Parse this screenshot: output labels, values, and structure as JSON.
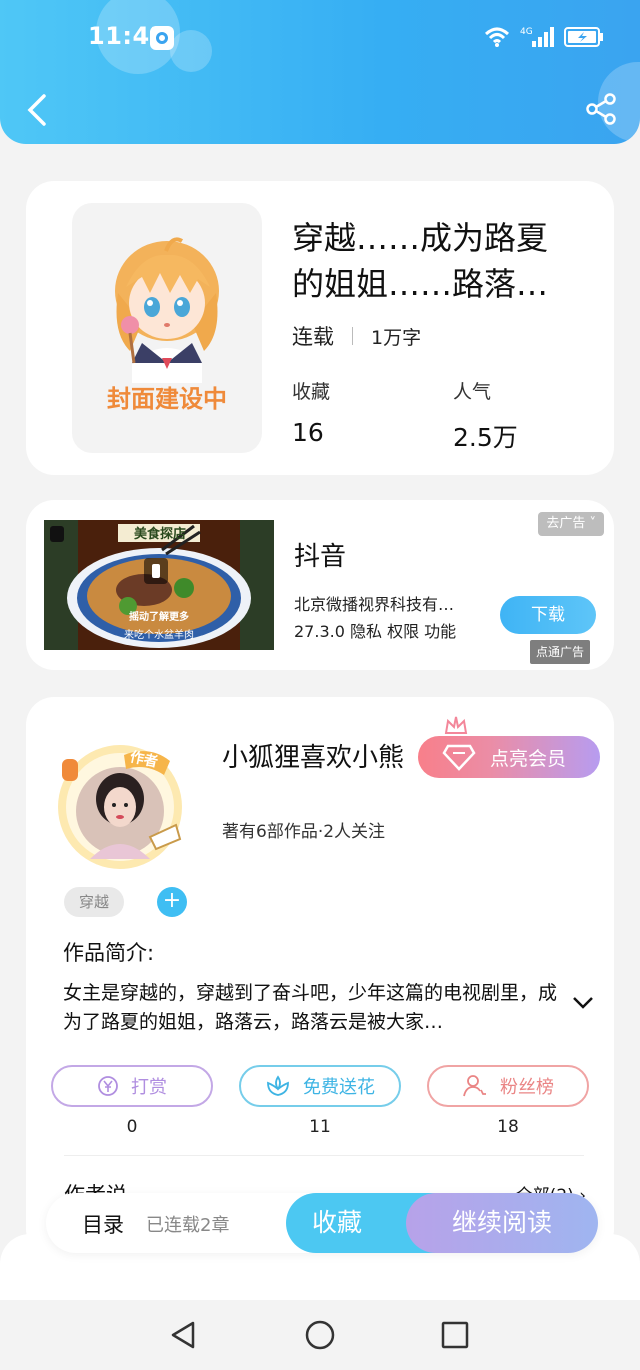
{
  "status_bar": {
    "time": "11:43",
    "network": "4G"
  },
  "book": {
    "title": "穿越……成为路夏的姐姐……路落…",
    "status": "连载",
    "word_count": "1万字",
    "cover_text": "封面建设中",
    "stats": [
      {
        "label": "收藏",
        "value": "16"
      },
      {
        "label": "人气",
        "value": "2.5万"
      }
    ]
  },
  "ad": {
    "app_name": "抖音",
    "company": "北京微播视界科技有…",
    "version_line": "27.3.0  隐私  权限  功能",
    "close_label": "去广告",
    "download_label": "下载",
    "source_label": "点通广告",
    "image_caption": "摇动了解更多",
    "image_sub": "来吃个水盆羊肉",
    "image_sign": "美食探店"
  },
  "author": {
    "name": "小狐狸喜欢小熊",
    "badge": "作者",
    "vip_label": "点亮会员",
    "works": "著有6部作品·2人关注",
    "tag": "穿越",
    "add_tag": "+",
    "intro_label": "作品简介:",
    "intro_text": "女主是穿越的，穿越到了奋斗吧，少年这篇的电视剧里，成为了路夏的姐姐，路落云，路落云是被大家…",
    "actions": [
      {
        "label": "打赏",
        "count": "0",
        "icon": "yen-icon"
      },
      {
        "label": "免费送花",
        "count": "11",
        "icon": "flower-icon"
      },
      {
        "label": "粉丝榜",
        "count": "18",
        "icon": "fans-icon"
      }
    ],
    "author_say": "作者说",
    "all_link": "全部(2)"
  },
  "bottom_bar": {
    "toc_label": "目录",
    "chapters": "已连载2章",
    "favorite_label": "收藏",
    "read_label": "继续阅读"
  },
  "colors": {
    "header_gradient": [
      "#4fc7f6",
      "#3aa4f0"
    ],
    "accent_blue": "#4cc8f2",
    "vip_gradient": [
      "#f87f8a",
      "#b79cf0"
    ]
  }
}
